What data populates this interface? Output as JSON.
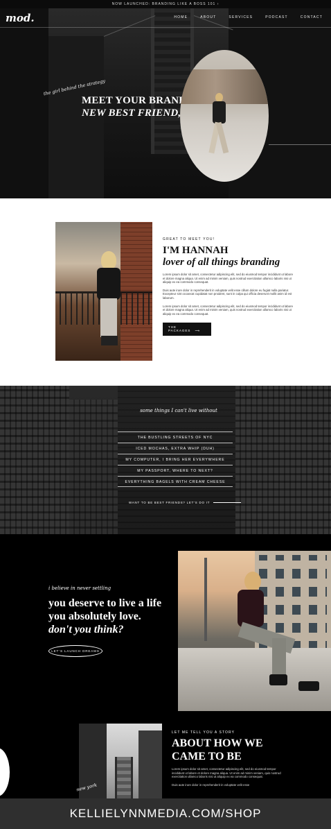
{
  "topbar": {
    "text": "NOW LAUNCHED: BRANDING LIKE A BOSS 101 ›"
  },
  "nav": {
    "logo": "mod.",
    "links": [
      "HOME",
      "ABOUT",
      "SERVICES",
      "PODCAST",
      "CONTACT"
    ]
  },
  "hero": {
    "script": "the girl behind the strategy",
    "headline_line1": "MEET YOUR BRAND'S",
    "headline_line2": "NEW BEST FRIEND, HANNAH"
  },
  "about": {
    "eyebrow": "GREAT TO MEET YOU!",
    "title": "I'M HANNAH",
    "title_italic": "lover of all things branding",
    "para1": "Lorem ipsum dolor sit amet, consectetur adipiscing elit, sed do eiusmod tempor incididunt ut labore et dolore magna aliqua. Ut enim ad minim veniam, quis nostrud exercitation ullamco laboris nisi ut aliquip ex ea commodo consequat.",
    "para2": "Duis aute irure dolor in reprehenderit in voluptate velit esse cillum dolore eu fugiat nulla pariatur. Excepteur sint occaecat cupidatat non proident, sunt in culpa qui officia deserunt mollit anim id est laborum.",
    "para3": "Lorem ipsum dolor sit amet, consectetur adipiscing elit, sed do eiusmod tempor incididunt ut labore et dolore magna aliqua. Ut enim ad minim veniam, quis nostrud exercitation ullamco laboris nisi ut aliquip ex ea commodo consequat.",
    "button": "THE PACKAGES",
    "button_arrow": "⟶"
  },
  "things": {
    "script": "some things I can't live without",
    "items": [
      "THE BUSTLING STREETS OF NYC",
      "ICED MOCHAS, EXTRA WHIP (DUH)",
      "MY COMPUTER, I BRING HER EVERYWHERE",
      "MY PASSPORT, WHERE TO NEXT?",
      "EVERYTHING BAGELS WITH CREAM CHEESE"
    ],
    "link": "WANT TO BE BEST FRIENDS? LET'S DO IT"
  },
  "believe": {
    "script": "i believe in never settling",
    "line1": "you deserve to live a life",
    "line2": "you absolutely love.",
    "line3": "don't you think?",
    "button": "LET'S LAUNCH DREAMS"
  },
  "story": {
    "script": "new york",
    "eyebrow": "LET ME TELL YOU A STORY",
    "title_line1": "ABOUT HOW WE",
    "title_line2": "CAME TO BE",
    "para1": "Lorem ipsum dolor sit amet, consectetur adipiscing elit, sed do eiusmod tempor incididunt ut labore et dolore magna aliqua. Ut enim ad minim veniam, quis nostrud exercitation ullamco laboris nisi ut aliquip ex ea commodo consequat.",
    "para2": "Duis aute irure dolor in reprehenderit in voluptate velit esse"
  },
  "footer": {
    "banner": "KELLIELYNNMEDIA.COM/SHOP"
  }
}
